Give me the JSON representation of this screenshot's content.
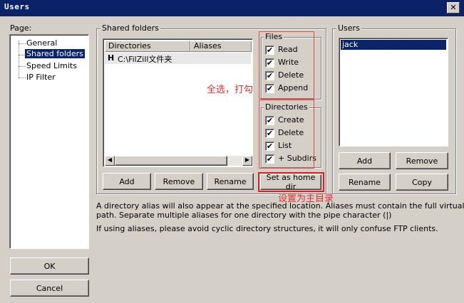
{
  "window": {
    "title": "Users",
    "close_glyph": "✕"
  },
  "page_panel": {
    "label": "Page:",
    "items": [
      "General",
      "Shared folders",
      "Speed Limits",
      "IP Filter"
    ],
    "selected": "Shared folders"
  },
  "shared_folders": {
    "label": "Shared folders",
    "columns": [
      "Directories",
      "Aliases"
    ],
    "rows": [
      {
        "flag": "H",
        "directory": "C:\\FilZill文件夹",
        "alias": ""
      }
    ],
    "buttons": {
      "add": "Add",
      "remove": "Remove",
      "rename": "Rename",
      "set_home": "Set as home dir"
    }
  },
  "files": {
    "label": "Files",
    "options": [
      {
        "label": "Read",
        "checked": true
      },
      {
        "label": "Write",
        "checked": true
      },
      {
        "label": "Delete",
        "checked": true
      },
      {
        "label": "Append",
        "checked": true
      }
    ]
  },
  "directories": {
    "label": "Directories",
    "options": [
      {
        "label": "Create",
        "checked": true
      },
      {
        "label": "Delete",
        "checked": true
      },
      {
        "label": "List",
        "checked": true
      },
      {
        "label": "+ Subdirs",
        "checked": true
      }
    ]
  },
  "users": {
    "label": "Users",
    "list": [
      "jack"
    ],
    "selected": "jack",
    "buttons": {
      "add": "Add",
      "remove": "Remove",
      "rename": "Rename",
      "copy": "Copy"
    }
  },
  "info": {
    "line1": "A directory alias will also appear at the specified location. Aliases must contain the full virtual",
    "line2": "path. Separate multiple aliases for one directory with the pipe character (|)",
    "line3": "If using aliases, please avoid cyclic directory structures, it will only confuse FTP clients."
  },
  "annotations": {
    "select_all": "全选，打勾",
    "set_home": "设置为主目录",
    "color": "#e03030"
  },
  "dialog_buttons": {
    "ok": "OK",
    "cancel": "Cancel"
  },
  "check_glyph": "✔"
}
